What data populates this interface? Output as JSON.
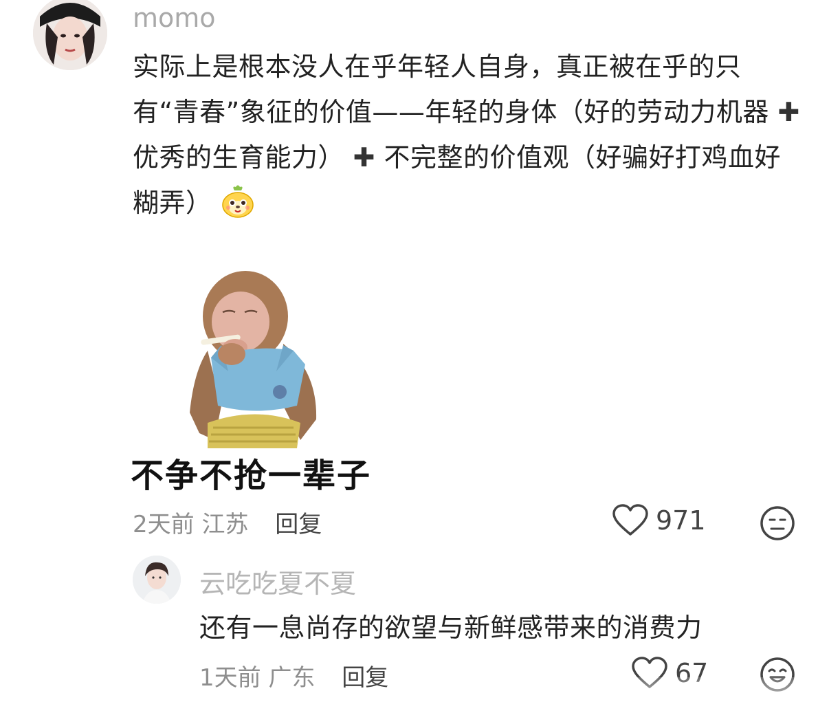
{
  "comment": {
    "username": "momo",
    "text_part1": "实际上是根本没人在乎年轻人自身，真正被在乎的只有“青春”象征的价值——年轻的身体（好的劳动力机器",
    "plus_icon": "heavy-plus-sign-icon",
    "text_part2": "优秀的生育能力）",
    "text_part3": "不完整的价值观（好骗好打鸡血好糊弄）",
    "emoji": "cute-character-emoji-icon",
    "sticker_caption": "不争不抢一辈子",
    "time": "2天前",
    "location": "江苏",
    "reply_label": "回复",
    "likes": "971",
    "like_icon": "heart-outline-icon",
    "reaction_icon": "neutral-face-icon"
  },
  "reply": {
    "username": "云吃吃夏不夏",
    "text": "还有一息尚存的欲望与新鲜感带来的消费力",
    "time": "1天前",
    "location": "广东",
    "reply_label": "回复",
    "likes": "67",
    "like_icon": "heart-outline-icon",
    "reaction_icon": "smiling-face-icon"
  },
  "colors": {
    "username": "#a9a9a9",
    "meta": "#8e8e8e",
    "text": "#222222",
    "background": "#ffffff"
  }
}
